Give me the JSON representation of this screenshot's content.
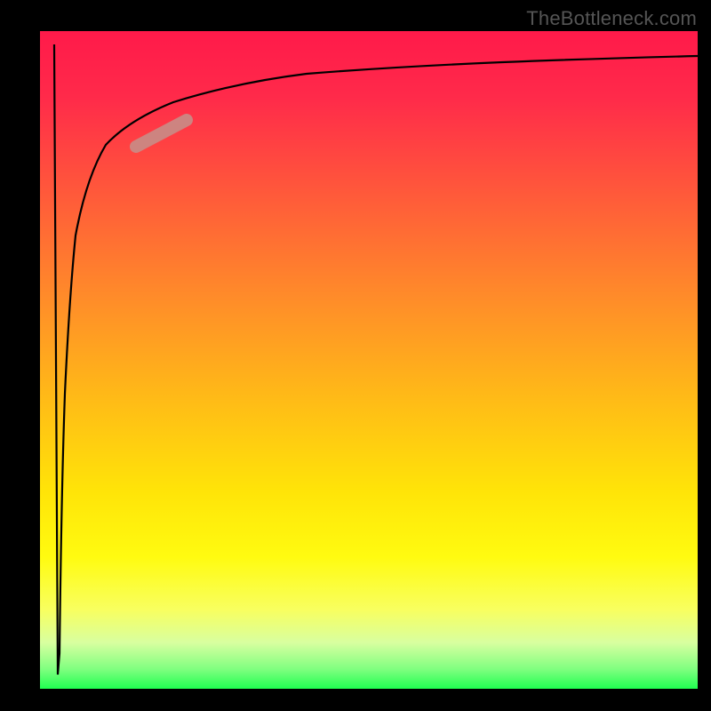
{
  "watermark": "TheBottleneck.com",
  "colors": {
    "background": "#000000",
    "gradient_top": "#ff1a4a",
    "gradient_mid": "#ffe408",
    "gradient_bottom": "#20ff50",
    "curve": "#000000",
    "highlight_pill": "#c98b86"
  },
  "chart_data": {
    "type": "line",
    "title": "",
    "xlabel": "",
    "ylabel": "",
    "xlim": [
      0,
      100
    ],
    "ylim": [
      0,
      100
    ],
    "series": [
      {
        "name": "curve",
        "x": [
          2,
          2.5,
          3,
          3.5,
          4,
          5,
          7,
          10,
          15,
          20,
          25,
          30,
          40,
          50,
          60,
          70,
          80,
          90,
          100
        ],
        "y": [
          98,
          50,
          5,
          30,
          55,
          72,
          80,
          85,
          88,
          90,
          91,
          92,
          93.5,
          94.5,
          95,
          95.5,
          96,
          96.3,
          96.5
        ]
      }
    ],
    "annotations": [
      {
        "name": "highlight-pill",
        "x_range": [
          15,
          22
        ],
        "y_range": [
          84,
          88
        ],
        "color": "#c98b86"
      }
    ],
    "grid": false,
    "legend": false
  }
}
